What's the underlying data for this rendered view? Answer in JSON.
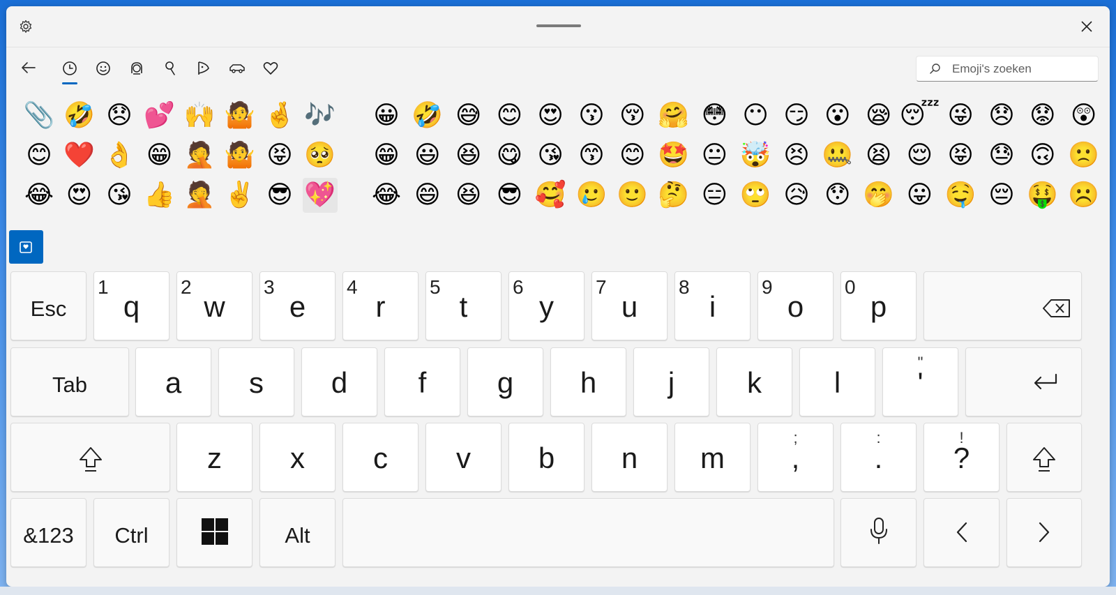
{
  "titlebar": {
    "settings_icon": "gear-icon",
    "close_icon": "close-icon"
  },
  "nav": {
    "back_icon": "arrow-left-icon",
    "categories": [
      "clock-icon",
      "smiley-icon",
      "kaomoji-icon",
      "symbols-icon",
      "gif-icon",
      "clipboard-icon",
      "heart-icon"
    ]
  },
  "search": {
    "placeholder": "Emoji's zoeken"
  },
  "accent_color": "#0067c0",
  "recent_emoji": [
    [
      "📎",
      "🤣",
      "😞",
      "💕",
      "🙌",
      "🤷",
      "🤞",
      "🎶"
    ],
    [
      "😊",
      "❤️",
      "👌",
      "😁",
      "🤦",
      "🤷",
      "😝",
      "🥺"
    ],
    [
      "😂",
      "😍",
      "😘",
      "👍",
      "🤦",
      "✌️",
      "😎",
      "💖"
    ]
  ],
  "all_emoji": [
    [
      "😀",
      "🤣",
      "😅",
      "😊",
      "😍",
      "😗",
      "😚",
      "🤗",
      "😳",
      "😶",
      "😏",
      "😮",
      "😪",
      "😴",
      "😜",
      "😞",
      "😟",
      "😲"
    ],
    [
      "😁",
      "😃",
      "😆",
      "😋",
      "😘",
      "😙",
      "😊",
      "🤩",
      "😐",
      "🤯",
      "😣",
      "🤐",
      "😫",
      "😌",
      "😝",
      "😓",
      "🙃",
      "🙁"
    ],
    [
      "😂",
      "😄",
      "😆",
      "😎",
      "🥰",
      "🥲",
      "🙂",
      "🤔",
      "😑",
      "🙄",
      "😥",
      "😯",
      "🤭",
      "😛",
      "🤤",
      "😔",
      "🤑",
      "☹️"
    ]
  ],
  "keyboard": {
    "row1": [
      {
        "label": "Esc"
      },
      {
        "num": "1",
        "ch": "q"
      },
      {
        "num": "2",
        "ch": "w"
      },
      {
        "num": "3",
        "ch": "e"
      },
      {
        "num": "4",
        "ch": "r"
      },
      {
        "num": "5",
        "ch": "t"
      },
      {
        "num": "6",
        "ch": "y"
      },
      {
        "num": "7",
        "ch": "u"
      },
      {
        "num": "8",
        "ch": "i"
      },
      {
        "num": "9",
        "ch": "o"
      },
      {
        "num": "0",
        "ch": "p"
      },
      {
        "icon": "backspace-icon"
      }
    ],
    "row2": [
      {
        "label": "Tab"
      },
      {
        "ch": "a"
      },
      {
        "ch": "s"
      },
      {
        "ch": "d"
      },
      {
        "ch": "f"
      },
      {
        "ch": "g"
      },
      {
        "ch": "h"
      },
      {
        "ch": "j"
      },
      {
        "ch": "k"
      },
      {
        "ch": "l"
      },
      {
        "sub": "\"",
        "ch": "'"
      },
      {
        "icon": "enter-icon"
      }
    ],
    "row3": [
      {
        "icon": "shift-icon"
      },
      {
        "ch": "z"
      },
      {
        "ch": "x"
      },
      {
        "ch": "c"
      },
      {
        "ch": "v"
      },
      {
        "ch": "b"
      },
      {
        "ch": "n"
      },
      {
        "ch": "m"
      },
      {
        "sub": ";",
        "ch": ","
      },
      {
        "sub": ":",
        "ch": "."
      },
      {
        "sub": "!",
        "ch": "?"
      },
      {
        "icon": "shift-icon"
      }
    ],
    "row4": [
      {
        "label": "&123"
      },
      {
        "label": "Ctrl"
      },
      {
        "icon": "windows-icon"
      },
      {
        "label": "Alt"
      },
      {
        "label": ""
      },
      {
        "icon": "microphone-icon"
      },
      {
        "icon": "chevron-left-icon"
      },
      {
        "icon": "chevron-right-icon"
      }
    ]
  }
}
